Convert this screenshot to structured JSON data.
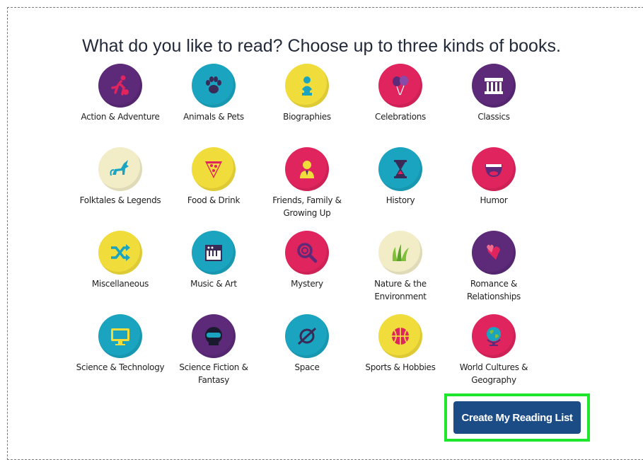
{
  "heading": "What do you like to read? Choose up to three kinds of books.",
  "categories": [
    {
      "label": "Action & Adventure",
      "icon": "running-figure-icon",
      "color": "#5c2a79"
    },
    {
      "label": "Animals & Pets",
      "icon": "paw-icon",
      "color": "#1aa4bf"
    },
    {
      "label": "Biographies",
      "icon": "bust-statue-icon",
      "color": "#f0dc3a"
    },
    {
      "label": "Celebrations",
      "icon": "balloons-icon",
      "color": "#e0245e"
    },
    {
      "label": "Classics",
      "icon": "columns-building-icon",
      "color": "#5c2a79"
    },
    {
      "label": "Folktales & Legends",
      "icon": "unicorn-icon",
      "color": "#f2edc7"
    },
    {
      "label": "Food & Drink",
      "icon": "pizza-slice-icon",
      "color": "#f0dc3a"
    },
    {
      "label": "Friends, Family & Growing Up",
      "icon": "person-icon",
      "color": "#e0245e"
    },
    {
      "label": "History",
      "icon": "hourglass-icon",
      "color": "#1aa4bf"
    },
    {
      "label": "Humor",
      "icon": "laughing-mouth-icon",
      "color": "#e0245e"
    },
    {
      "label": "Miscellaneous",
      "icon": "shuffle-icon",
      "color": "#f0dc3a"
    },
    {
      "label": "Music & Art",
      "icon": "keyboard-icon",
      "color": "#1aa4bf"
    },
    {
      "label": "Mystery",
      "icon": "magnifying-glass-icon",
      "color": "#e0245e"
    },
    {
      "label": "Nature & the Environment",
      "icon": "grass-icon",
      "color": "#f2edc7"
    },
    {
      "label": "Romance & Relationships",
      "icon": "hearts-icon",
      "color": "#5c2a79"
    },
    {
      "label": "Science & Technology",
      "icon": "computer-monitor-icon",
      "color": "#1aa4bf"
    },
    {
      "label": "Science Fiction & Fantasy",
      "icon": "astronaut-helmet-icon",
      "color": "#5c2a79"
    },
    {
      "label": "Space",
      "icon": "planet-icon",
      "color": "#1aa4bf"
    },
    {
      "label": "Sports & Hobbies",
      "icon": "basketball-icon",
      "color": "#f0dc3a"
    },
    {
      "label": "World Cultures & Geography",
      "icon": "globe-icon",
      "color": "#e0245e"
    }
  ],
  "cta": {
    "label": "Create My Reading List",
    "color": "#1b4c86",
    "highlight": "#1ee62d"
  }
}
